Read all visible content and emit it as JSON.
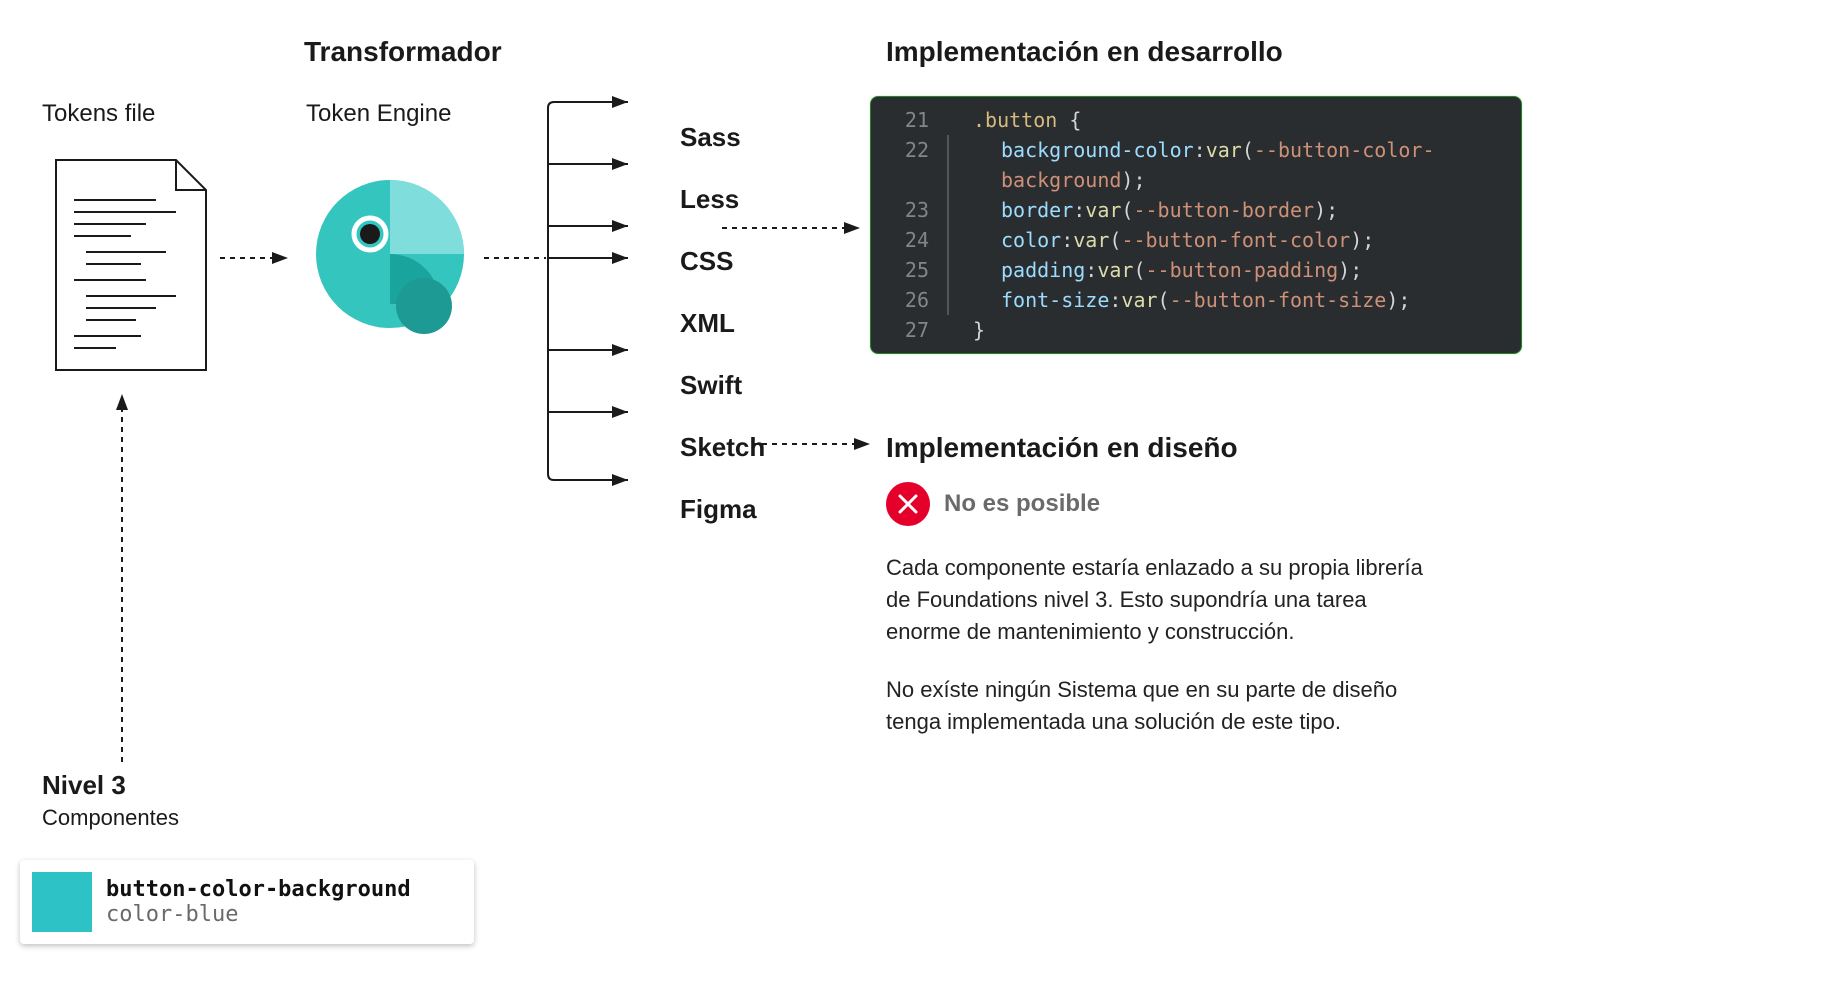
{
  "tokensFile": {
    "label": "Tokens file"
  },
  "transformer": {
    "title": "Transformador",
    "subtitle": "Token Engine"
  },
  "outputs": [
    "Sass",
    "Less",
    "CSS",
    "XML",
    "Swift",
    "Sketch",
    "Figma"
  ],
  "dev": {
    "title": "Implementación en desarrollo",
    "startLine": 21,
    "selector": ".button",
    "props": [
      {
        "name": "background-color",
        "var": "--button-color-background"
      },
      {
        "name": "border",
        "var": "--button-border"
      },
      {
        "name": "color",
        "var": "--button-font-color"
      },
      {
        "name": "padding",
        "var": "--button-padding"
      },
      {
        "name": "font-size",
        "var": "--button-font-size"
      }
    ]
  },
  "design": {
    "title": "Implementación en diseño",
    "impossible": "No es posible",
    "para1": "Cada componente estaría enlazado a su propia librería de Foundations nivel 3. Esto supondría una tarea enorme de mantenimiento y construcción.",
    "para2": "No exíste ningún Sistema que en su parte de diseño tenga implementada una solución de este tipo."
  },
  "nivel3": {
    "title": "Nivel 3",
    "subtitle": "Componentes"
  },
  "tokenChip": {
    "name": "button-color-background",
    "value": "color-blue"
  }
}
